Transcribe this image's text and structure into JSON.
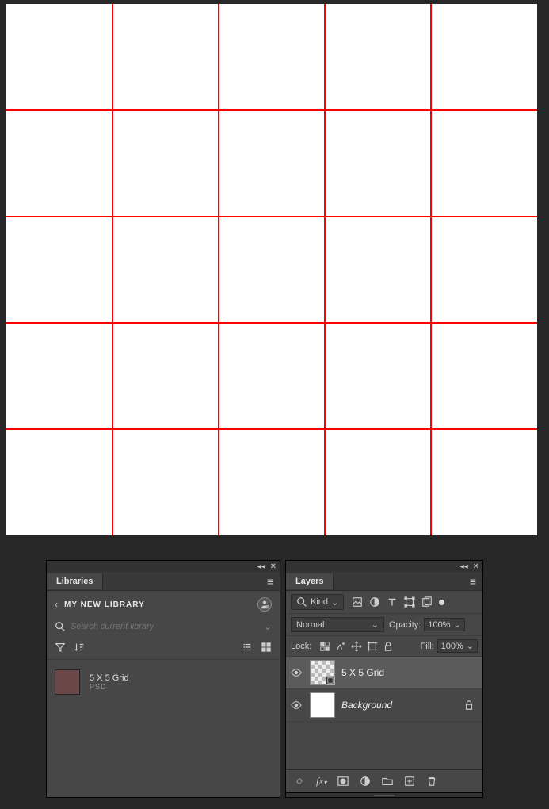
{
  "canvas": {
    "grid": {
      "rows": 5,
      "cols": 5,
      "line_color": "#ff0000",
      "bg": "#ffffff"
    }
  },
  "libraries_panel": {
    "tab_label": "Libraries",
    "library_name": "MY NEW LIBRARY",
    "search_placeholder": "Search current library",
    "item_name": "5 X 5 Grid",
    "item_type": "PSD"
  },
  "layers_panel": {
    "tab_label": "Layers",
    "filter_label": "Kind",
    "blend_mode": "Normal",
    "opacity_label": "Opacity:",
    "opacity_value": "100%",
    "lock_label": "Lock:",
    "fill_label": "Fill:",
    "fill_value": "100%",
    "layers": [
      {
        "name": "5 X 5 Grid",
        "selected": true,
        "smart": true,
        "locked": false,
        "italic": false
      },
      {
        "name": "Background",
        "selected": false,
        "smart": false,
        "locked": true,
        "italic": true
      }
    ]
  }
}
